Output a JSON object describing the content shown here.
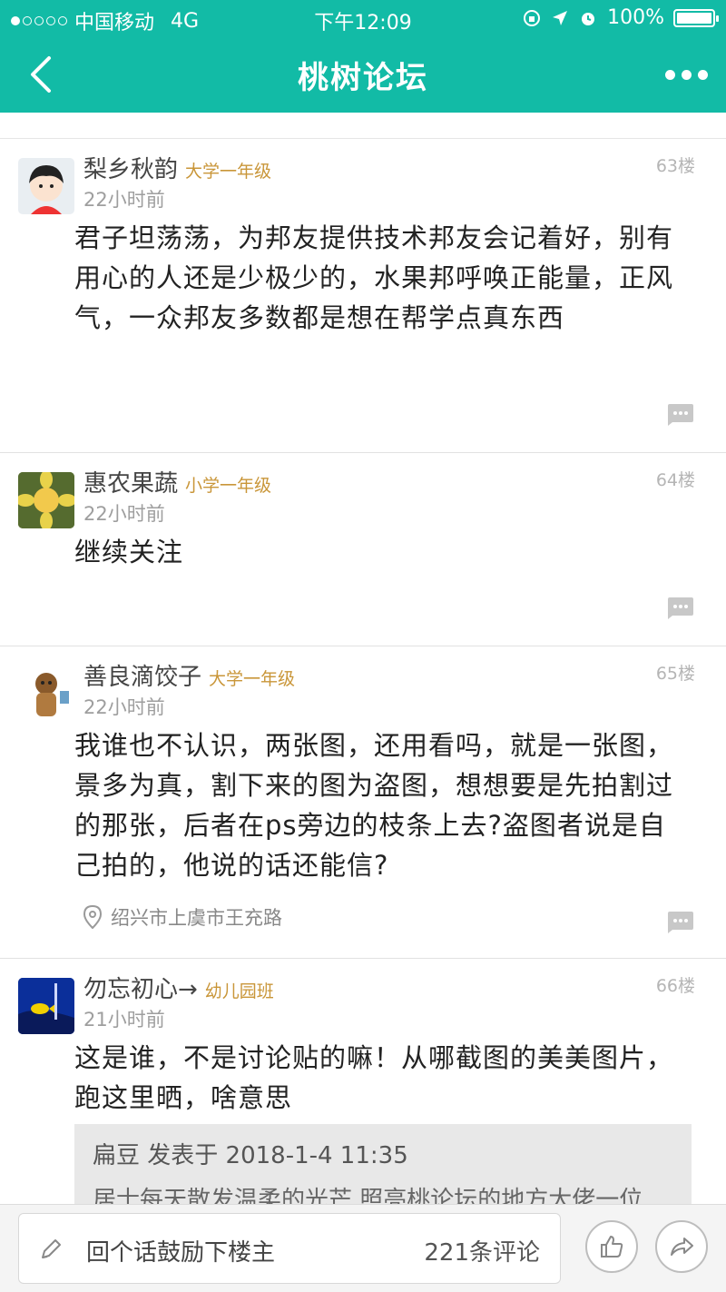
{
  "status_bar": {
    "carrier": "中国移动",
    "network": "4G",
    "time": "下午12:09",
    "battery": "100%"
  },
  "nav": {
    "title": "桃树论坛"
  },
  "posts": [
    {
      "username": "梨乡秋韵",
      "level": "大学一年级",
      "time": "22小时前",
      "floor": "63楼",
      "content": "君子坦荡荡，为邦友提供技术邦友会记着好，别有用心的人还是少极少的，水果邦呼唤正能量，正风气，一众邦友多数都是想在帮学点真东西"
    },
    {
      "username": "惠农果蔬",
      "level": "小学一年级",
      "time": "22小时前",
      "floor": "64楼",
      "content": "继续关注"
    },
    {
      "username": "善良滴饺子",
      "level": "大学一年级",
      "time": "22小时前",
      "floor": "65楼",
      "content": "我谁也不认识，两张图，还用看吗，就是一张图，景多为真，割下来的图为盗图，想想要是先拍割过的那张，后者在ps旁边的枝条上去?盗图者说是自己拍的，他说的话还能信?",
      "location": "绍兴市上虞市王充路"
    },
    {
      "username": "勿忘初心→",
      "level": "幼儿园班",
      "time": "21小时前",
      "floor": "66楼",
      "content": "这是谁，不是讨论贴的嘛！从哪截图的美美图片，跑这里晒，啥意思",
      "quote_head": "扁豆 发表于 2018-1-4 11:35",
      "quote_body": "居士每天散发温柔的光芒 照亮桃论坛的地方大佬一位"
    }
  ],
  "bottom_bar": {
    "reply_placeholder": "回个话鼓励下楼主",
    "comment_count": "221条评论"
  },
  "colors": {
    "header": "#12bba6",
    "level": "#c99639"
  }
}
